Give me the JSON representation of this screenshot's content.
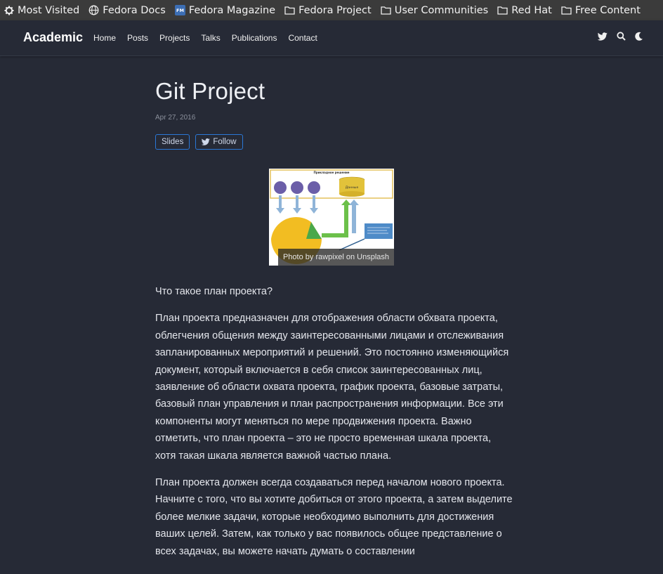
{
  "bookmarks": [
    {
      "label": "Most Visited",
      "icon": "gear-icon"
    },
    {
      "label": "Fedora Docs",
      "icon": "globe-icon"
    },
    {
      "label": "Fedora Magazine",
      "icon": "fm-icon"
    },
    {
      "label": "Fedora Project",
      "icon": "folder-icon"
    },
    {
      "label": "User Communities",
      "icon": "folder-icon"
    },
    {
      "label": "Red Hat",
      "icon": "folder-icon"
    },
    {
      "label": "Free Content",
      "icon": "folder-icon"
    }
  ],
  "navbar": {
    "brand": "Academic",
    "links": [
      "Home",
      "Posts",
      "Projects",
      "Talks",
      "Publications",
      "Contact"
    ],
    "icons": [
      "twitter-icon",
      "search-icon",
      "moon-icon"
    ]
  },
  "article": {
    "title": "Git Project",
    "date": "Apr 27, 2016",
    "buttons": {
      "slides": "Slides",
      "follow": "Follow"
    },
    "image": {
      "caption": "Photo by rawpixel on Unsplash",
      "diagram_labels": {
        "top": "Прикладное решение",
        "db": "Данные"
      }
    },
    "paragraphs": [
      "Что такое план проекта?",
      "План проекта предназначен для отображения области обхвата проекта, облегчения общения между заинтересованными лицами и отслеживания запланированных мероприятий и решений. Это постоянно изменяющийся документ, который включается в себя список заинтересованных лиц, заявление об области охвата проекта, график проекта, базовые затраты, базовый план управления и план распространения информации. Все эти компоненты могут меняться по мере продвижения проекта. Важно отметить, что план проекта – это не просто временная шкала проекта, хотя такая шкала является важной частью плана.",
      "План проекта должен всегда создаваться перед началом нового проекта. Начните с того, что вы хотите добиться от этого проекта, а затем выделите более мелкие задачи, которые необходимо выполнить для достижения ваших целей. Затем, как только у вас появилось общее представление о всех задачах, вы можете начать думать о составлении"
    ]
  },
  "colors": {
    "background": "#262a36",
    "bookmarks_bar": "#3b3b3b",
    "accent": "#2b78d7"
  }
}
